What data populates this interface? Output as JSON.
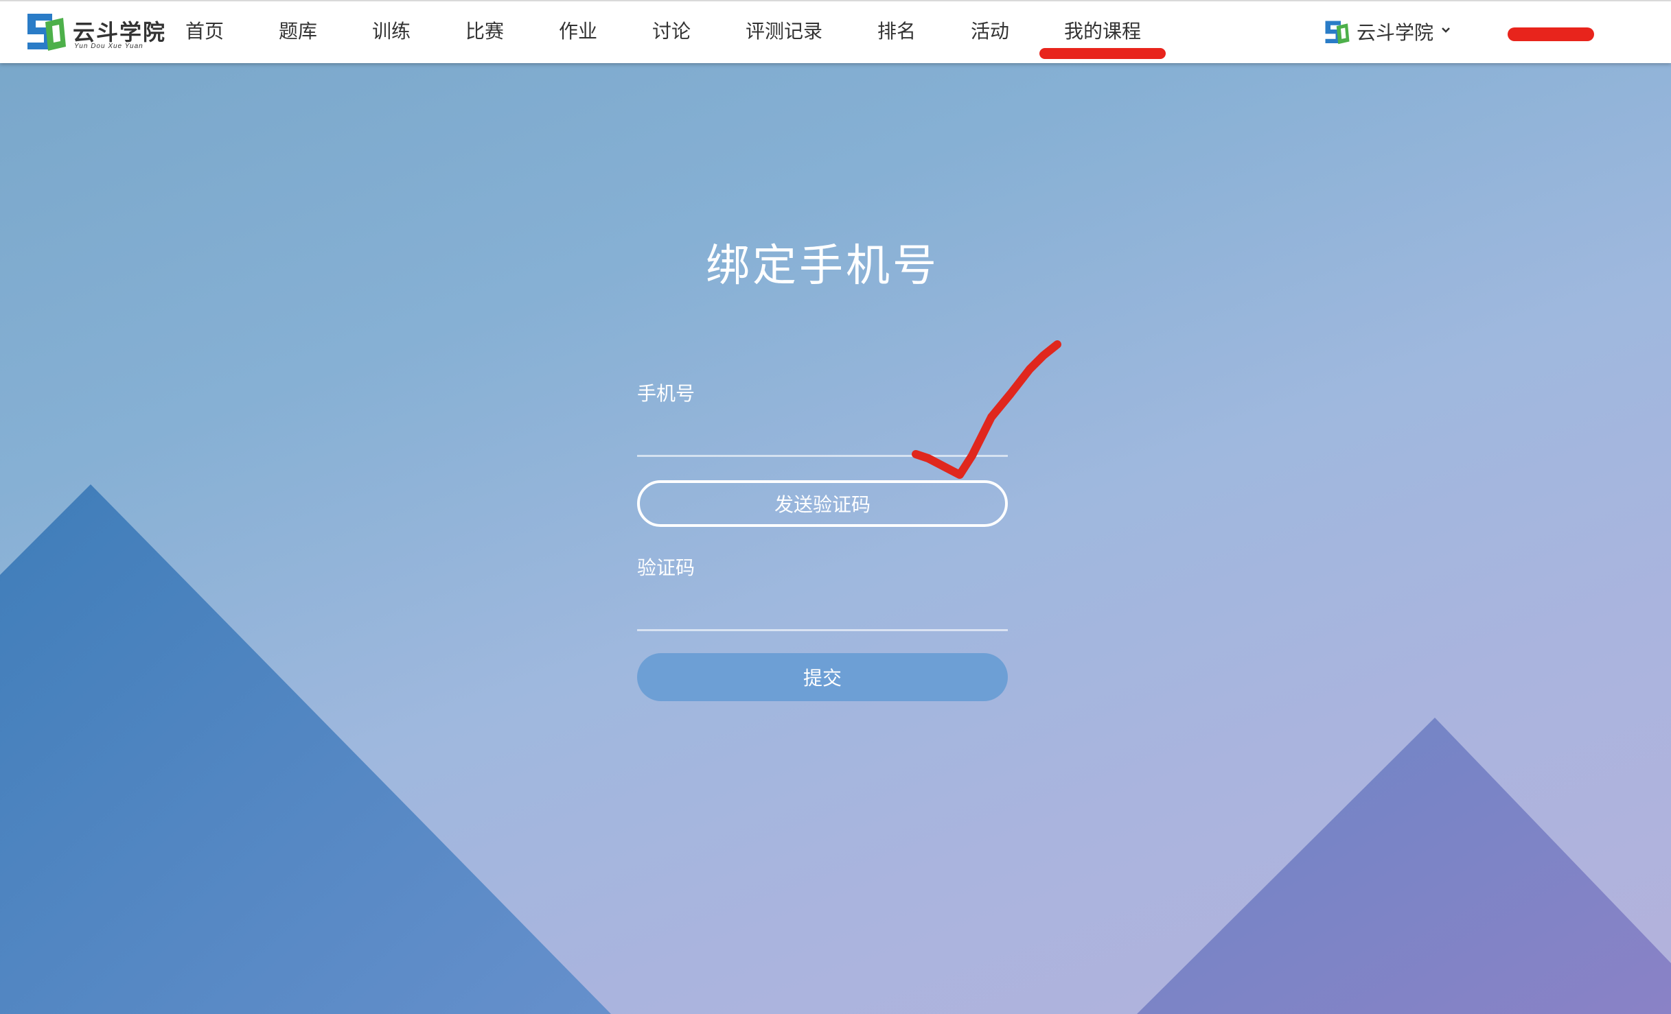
{
  "brand": {
    "title": "云斗学院",
    "subtitle": "Yun Dou Xue Yuan"
  },
  "nav": {
    "items": [
      {
        "label": "首页"
      },
      {
        "label": "题库"
      },
      {
        "label": "训练"
      },
      {
        "label": "比赛"
      },
      {
        "label": "作业"
      },
      {
        "label": "讨论"
      },
      {
        "label": "评测记录"
      },
      {
        "label": "排名"
      },
      {
        "label": "活动"
      },
      {
        "label": "我的课程"
      }
    ]
  },
  "site_switch": {
    "label": "云斗学院",
    "icon": "chevron-down-icon"
  },
  "form": {
    "title": "绑定手机号",
    "phone_label": "手机号",
    "phone_value": "",
    "send_code_label": "发送验证码",
    "code_label": "验证码",
    "code_value": "",
    "submit_label": "提交"
  },
  "colors": {
    "accent_red": "#e8241c",
    "submit_button": "#6d9fd5",
    "mountain_left": "#4a84c0",
    "mountain_right": "#7a7fc4"
  }
}
